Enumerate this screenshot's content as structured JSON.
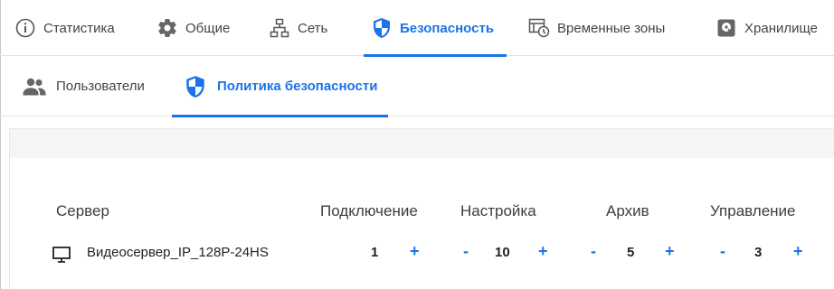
{
  "top_tabs": [
    {
      "label": "Статистика",
      "icon": "info-icon"
    },
    {
      "label": "Общие",
      "icon": "gear-icon"
    },
    {
      "label": "Сеть",
      "icon": "network-icon"
    },
    {
      "label": "Безопасность",
      "icon": "shield-icon",
      "active": true
    },
    {
      "label": "Временные зоны",
      "icon": "timezone-icon"
    },
    {
      "label": "Хранилище",
      "icon": "storage-icon"
    }
  ],
  "sub_tabs": [
    {
      "label": "Пользователи",
      "icon": "users-icon"
    },
    {
      "label": "Политика безопасности",
      "icon": "shield-icon",
      "active": true
    }
  ],
  "table": {
    "columns": [
      "Сервер",
      "Подключение",
      "Настройка",
      "Архив",
      "Управление"
    ],
    "rows": [
      {
        "server": "Видеосервер_IP_128P-24HS",
        "connection": "1",
        "settings": "10",
        "archive": "5",
        "management": "3",
        "minus": "-",
        "plus": "+"
      }
    ]
  },
  "colors": {
    "accent": "#1a73e8",
    "text": "#444444",
    "band": "#f5f5f5"
  }
}
